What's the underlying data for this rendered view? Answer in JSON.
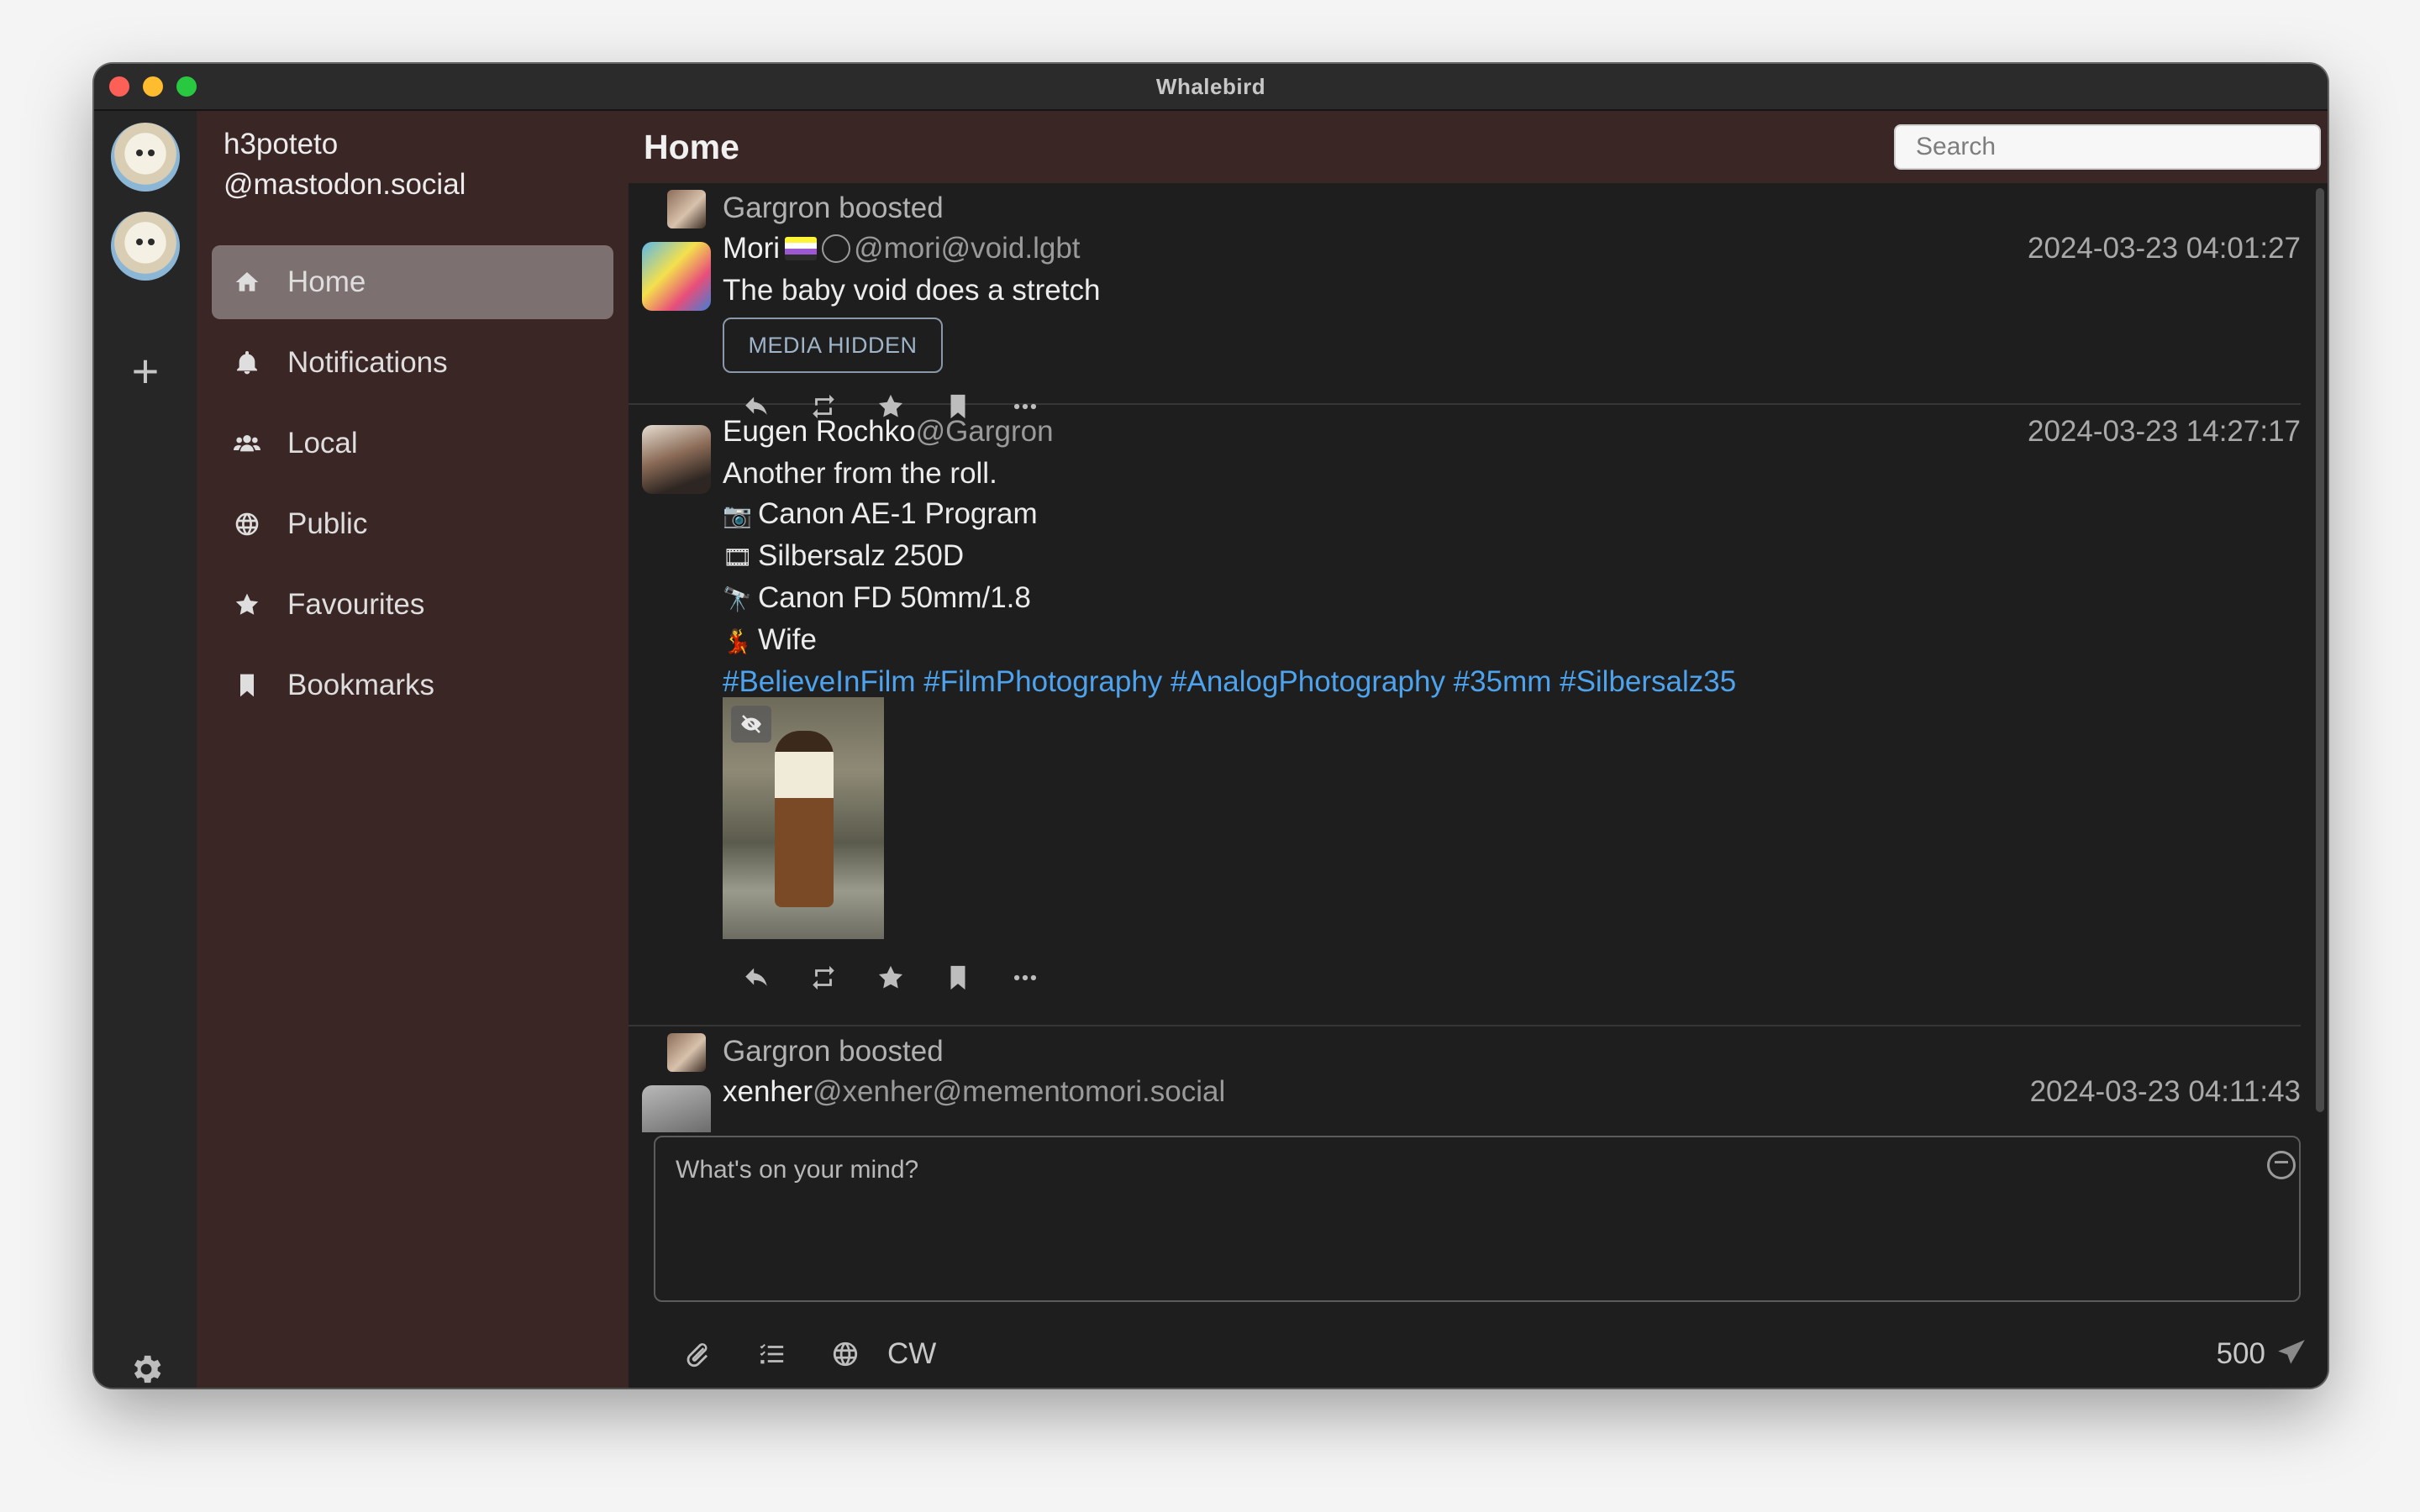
{
  "window": {
    "title": "Whalebird"
  },
  "account": {
    "name": "h3poteto",
    "handle": "@mastodon.social"
  },
  "rail": {
    "add_label": "+"
  },
  "nav": [
    {
      "label": "Home",
      "icon": "home-icon"
    },
    {
      "label": "Notifications",
      "icon": "bell-icon"
    },
    {
      "label": "Local",
      "icon": "users-icon"
    },
    {
      "label": "Public",
      "icon": "globe-icon"
    },
    {
      "label": "Favourites",
      "icon": "star-icon"
    },
    {
      "label": "Bookmarks",
      "icon": "bookmark-icon"
    }
  ],
  "header": {
    "title": "Home",
    "search_placeholder": "Search"
  },
  "posts": [
    {
      "boosted_by": "Gargron boosted",
      "display_name": "Mori",
      "acct": "@mori@void.lgbt",
      "date": "2024-03-23 04:01:27",
      "body": "The baby void does a stretch",
      "media_hidden_label": "MEDIA HIDDEN"
    },
    {
      "display_name": "Eugen Rochko",
      "acct": "@Gargron",
      "date": "2024-03-23 14:27:17",
      "lines": [
        "Another from the roll.",
        "Canon AE-1 Program",
        "Silbersalz 250D",
        "Canon FD 50mm/1.8",
        "Wife"
      ],
      "line_emoji": [
        "",
        "📷",
        "🎞",
        "🔭",
        "💃"
      ],
      "hashtags": "#BelieveInFilm #FilmPhotography #AnalogPhotography #35mm #Silbersalz35"
    },
    {
      "boosted_by": "Gargron boosted",
      "display_name": "xenher",
      "acct": "@xenher@mementomori.social",
      "date": "2024-03-23 04:11:43"
    }
  ],
  "composer": {
    "placeholder": "What's on your mind?",
    "cw_label": "CW",
    "char_count": "500"
  },
  "colors": {
    "sidebar": "#3b2626",
    "rail": "#262626",
    "content": "#1e1e1e",
    "active_nav": "#7d7070",
    "link": "#4ea3ee"
  }
}
